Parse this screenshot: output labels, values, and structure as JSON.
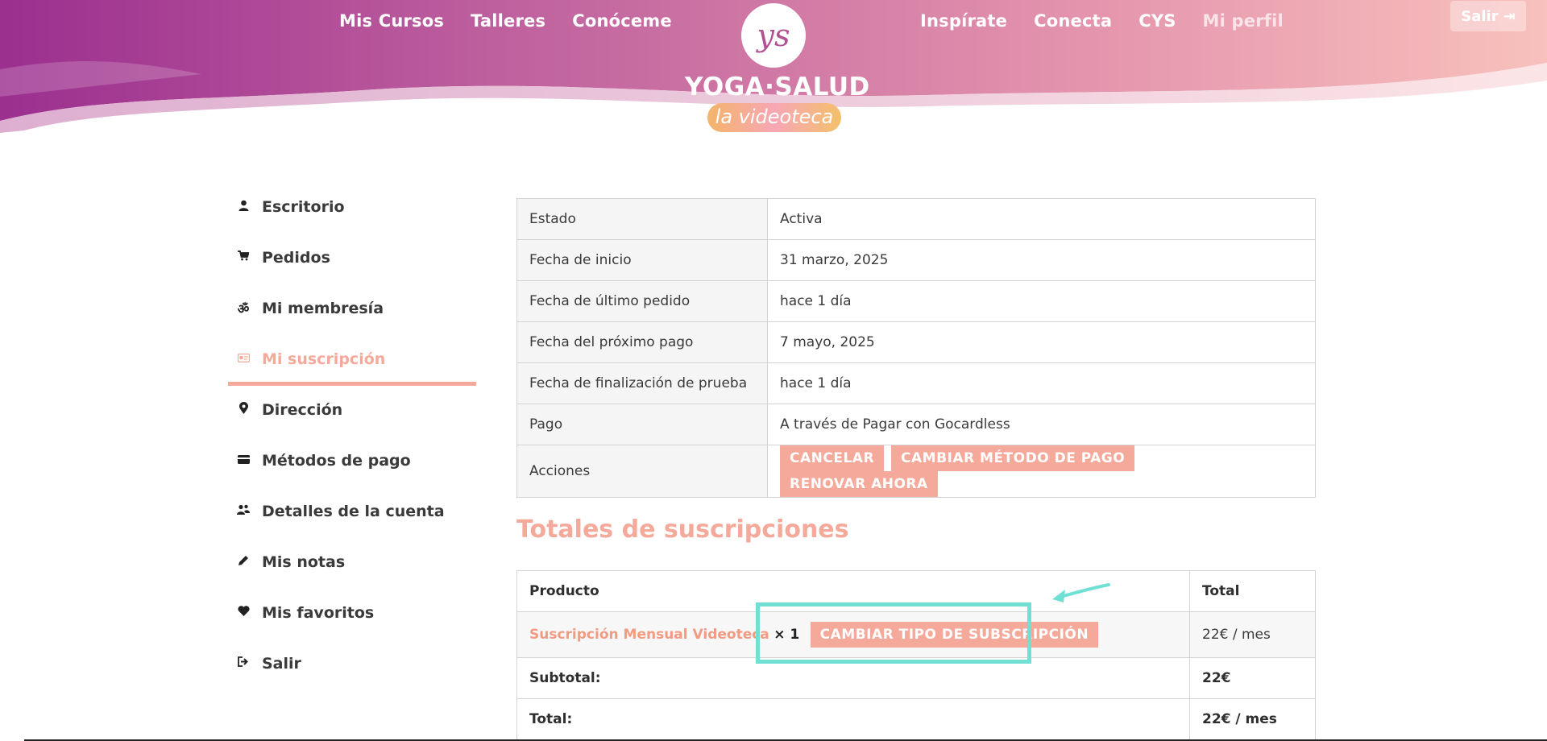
{
  "header": {
    "nav_left": [
      "Mis Cursos",
      "Talleres",
      "Conóceme"
    ],
    "nav_right": [
      "Inspírate",
      "Conecta",
      "CYS",
      "Mi perfil"
    ],
    "logo_title": "YOGA·SALUD",
    "logo_sub": "la videoteca",
    "logout_label": "Salir"
  },
  "sidebar": {
    "items": [
      {
        "label": "Escritorio",
        "icon": "user-icon"
      },
      {
        "label": "Pedidos",
        "icon": "cart-icon"
      },
      {
        "label": "Mi membresía",
        "icon": "om-icon"
      },
      {
        "label": "Mi suscripción",
        "icon": "card-id-icon"
      },
      {
        "label": "Dirección",
        "icon": "location-pin-icon"
      },
      {
        "label": "Métodos de pago",
        "icon": "credit-card-icon"
      },
      {
        "label": "Detalles de la cuenta",
        "icon": "users-icon"
      },
      {
        "label": "Mis notas",
        "icon": "pencil-icon"
      },
      {
        "label": "Mis favoritos",
        "icon": "heart-icon"
      },
      {
        "label": "Salir",
        "icon": "logout-icon"
      }
    ],
    "active_index": 3
  },
  "details": {
    "rows": [
      {
        "label": "Estado",
        "value": "Activa"
      },
      {
        "label": "Fecha de inicio",
        "value": "31 marzo, 2025"
      },
      {
        "label": "Fecha de último pedido",
        "value": "hace 1 día"
      },
      {
        "label": "Fecha del próximo pago",
        "value": "7 mayo, 2025"
      },
      {
        "label": "Fecha de finalización de prueba",
        "value": "hace 1 día"
      },
      {
        "label": "Pago",
        "value": "A través de Pagar con Gocardless"
      }
    ],
    "actions_label": "Acciones",
    "actions": [
      "CANCELAR",
      "CAMBIAR MÉTODO DE PAGO",
      "RENOVAR AHORA"
    ]
  },
  "totals": {
    "title": "Totales de suscripciones",
    "col_product": "Producto",
    "col_total": "Total",
    "product_name": "Suscripción Mensual Videoteca",
    "product_qty": "× 1",
    "change_button": "CAMBIAR TIPO DE SUBSCRIPCIÓN",
    "product_total": "22€ / mes",
    "subtotal_label": "Subtotal:",
    "subtotal_value": "22€",
    "total_label": "Total:",
    "total_value": "22€ / mes"
  },
  "colors": {
    "accent": "#f5a99a",
    "highlight": "#6fe0d3",
    "header_start": "#9c2f8f",
    "header_end": "#f6b4b0"
  }
}
